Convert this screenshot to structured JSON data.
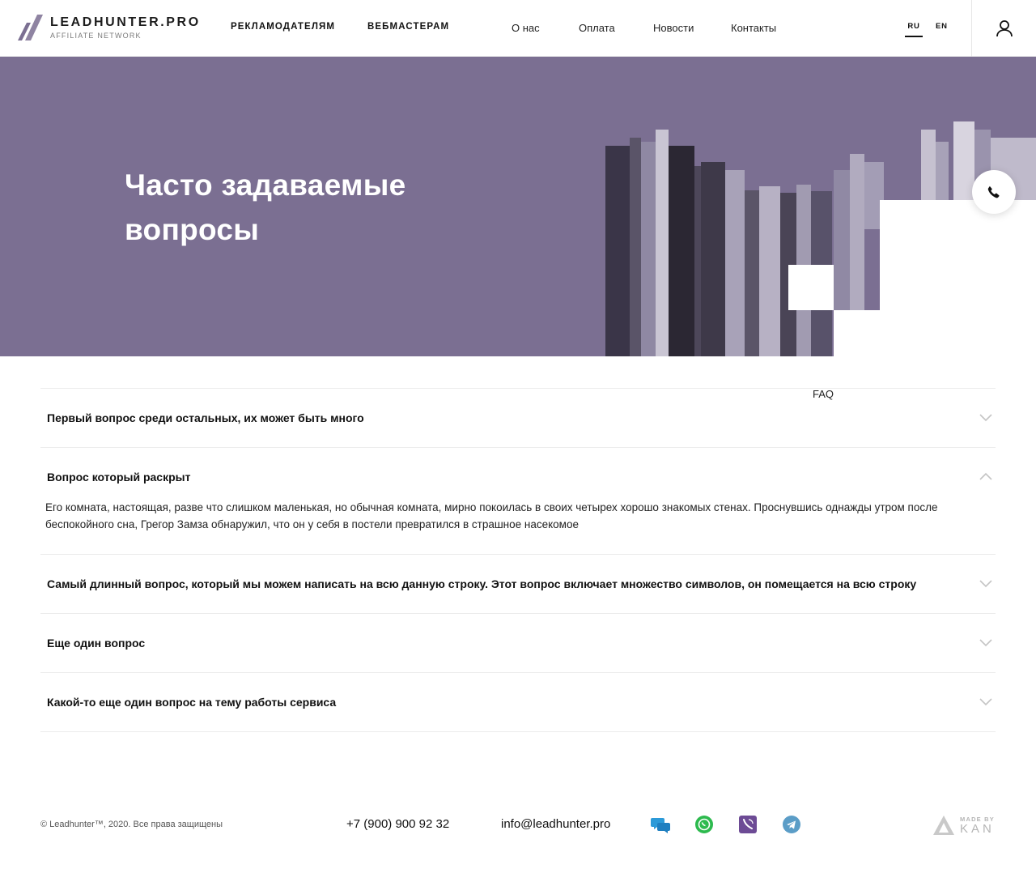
{
  "header": {
    "logo_title": "LEADHUNTER.PRO",
    "logo_subtitle": "AFFILIATE NETWORK",
    "nav_main": [
      "РЕКЛАМОДАТЕЛЯМ",
      "ВЕБМАСТЕРАМ"
    ],
    "nav_secondary": [
      "О нас",
      "Оплата",
      "Новости",
      "Контакты",
      "FAQ"
    ],
    "languages": [
      "RU",
      "EN"
    ],
    "active_language": "RU",
    "profile_icon": "user-icon"
  },
  "hero": {
    "title": "Часто задаваемые вопросы",
    "background_color": "#7b6f92",
    "call_icon": "phone-icon"
  },
  "faq": {
    "items": [
      {
        "question": "Первый вопрос среди остальных, их может быть много",
        "expanded": false,
        "answer": ""
      },
      {
        "question": "Вопрос который раскрыт",
        "expanded": true,
        "answer": "Его комната, настоящая, разве что слишком маленькая, но обычная комната, мирно покоилась в своих четырех хорошо знакомых стенах. Проснувшись однажды утром после беспокойного сна, Грегор Замза обнаружил, что он у себя в постели превратился в страшное насекомое"
      },
      {
        "question": "Самый длинный вопрос, который мы можем написать на всю данную строку. Этот вопрос включает множество символов, он помещается на всю строку",
        "expanded": false,
        "answer": ""
      },
      {
        "question": "Еще один вопрос",
        "expanded": false,
        "answer": ""
      },
      {
        "question": "Какой-то еще один вопрос на тему работы сервиса",
        "expanded": false,
        "answer": ""
      }
    ]
  },
  "footer": {
    "copyright": "© Leadhunter™, 2020. Все права защищены",
    "phone": "+7 (900) 900 92 32",
    "email": "info@leadhunter.pro",
    "messengers": [
      "chat-icon",
      "whatsapp-icon",
      "viber-icon",
      "telegram-icon"
    ],
    "made_by_small": "MADE BY",
    "made_by_big": "KAN"
  }
}
